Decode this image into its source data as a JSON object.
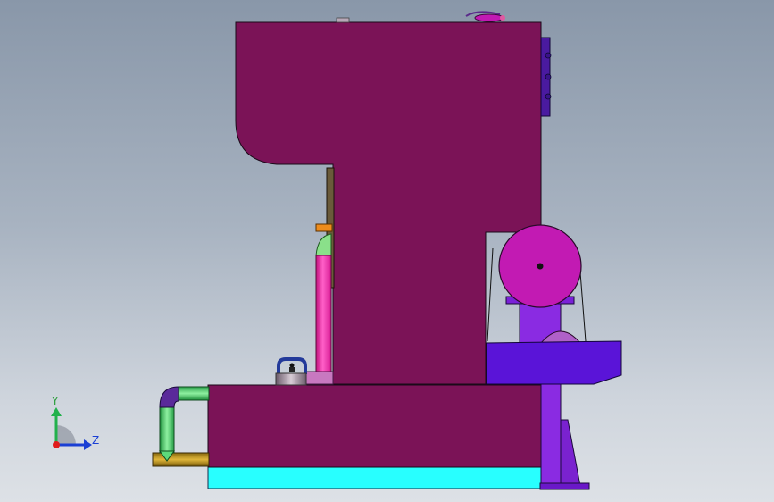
{
  "viewport": {
    "background_top": "#8997a9",
    "background_bottom": "#dde1e6"
  },
  "model_colors": {
    "frame": "#7b1357",
    "base": "#7b1357",
    "base_plate": "#28ffff",
    "flywheel": "#c21ab3",
    "motor_stand": "#8a2be2",
    "gearbox": "#5a14d8",
    "pink_cylinder": "#ff3ab4",
    "green_pipe": "#4ccf6a",
    "gold_pipe": "#c29a1f",
    "orange_clamp": "#ee8c1c",
    "blue_handle": "#233a9a"
  },
  "triad": {
    "y_label": "Y",
    "z_label": "Z",
    "y_color": "#22b14c",
    "z_color": "#1a3fd4",
    "x_color": "#e01b1b"
  },
  "icons": [
    "triad-icon"
  ]
}
